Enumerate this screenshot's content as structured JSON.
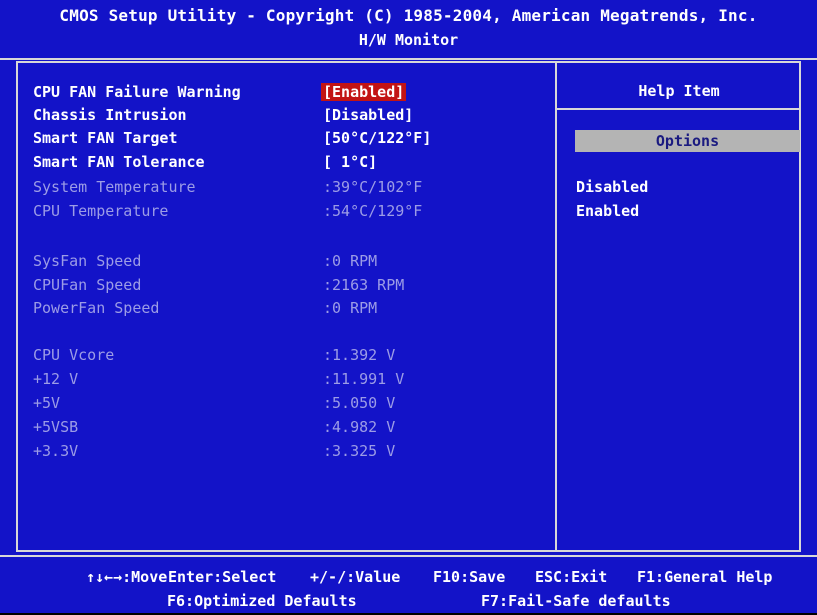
{
  "header": {
    "title": "CMOS Setup Utility - Copyright (C) 1985-2004, American Megatrends, Inc.",
    "page": "H/W Monitor"
  },
  "settings": [
    {
      "label": "CPU FAN Failure Warning",
      "value": "[Enabled]"
    },
    {
      "label": "Chassis Intrusion",
      "value": "[Disabled]"
    },
    {
      "label": "Smart FAN Target",
      "value": "[50°C/122°F]"
    },
    {
      "label": "Smart FAN Tolerance",
      "value": "[ 1°C]"
    }
  ],
  "temperatures": [
    {
      "label": "System Temperature",
      "value": ":39°C/102°F"
    },
    {
      "label": "CPU Temperature",
      "value": ":54°C/129°F"
    }
  ],
  "fans": [
    {
      "label": "SysFan Speed",
      "value": ":0 RPM"
    },
    {
      "label": "CPUFan Speed",
      "value": ":2163 RPM"
    },
    {
      "label": "PowerFan Speed",
      "value": ":0 RPM"
    }
  ],
  "voltages": [
    {
      "label": "CPU Vcore",
      "value": ":1.392 V"
    },
    {
      "label": "+12 V",
      "value": ":11.991 V"
    },
    {
      "label": "+5V",
      "value": ":5.050 V"
    },
    {
      "label": "+5VSB",
      "value": ":4.982 V"
    },
    {
      "label": "+3.3V",
      "value": ":3.325 V"
    }
  ],
  "help": {
    "title": "Help Item",
    "options_header": "Options",
    "options": [
      "Disabled",
      "Enabled"
    ]
  },
  "footer": {
    "move": "↑↓←→:Move",
    "select": "Enter:Select",
    "value": "+/-/:Value",
    "save": "F10:Save",
    "exit": "ESC:Exit",
    "help": "F1:General Help",
    "optimized": "F6:Optimized Defaults",
    "failsafe": "F7:Fail-Safe defaults"
  },
  "colors": {
    "background": "#1313c8",
    "selected": "#c21414",
    "text": "#ffffff",
    "dim_text": "#9c9ce6",
    "options_box": "#b4b4b4"
  }
}
